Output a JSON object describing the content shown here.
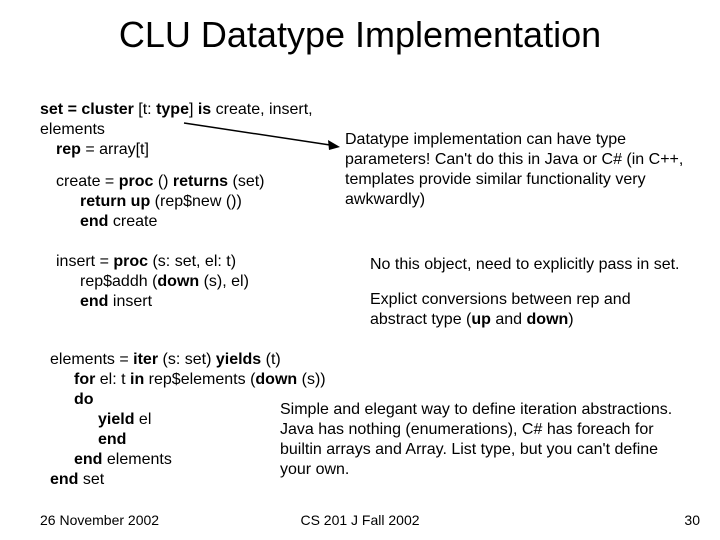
{
  "title": "CLU Datatype Implementation",
  "code": {
    "l1a": "set = cluster ",
    "l1b": "[t: ",
    "l1c": "type",
    "l1d": "] ",
    "l1e": "is ",
    "l1f": "create, insert, elements",
    "l2a": "rep ",
    "l2b": "= array[t]",
    "l3a": "create = ",
    "l3b": "proc",
    "l3c": " () ",
    "l3d": "returns",
    "l3e": " (set)",
    "l4a": "return ",
    "l4b": "up ",
    "l4c": "(rep$new ())",
    "l5a": "end ",
    "l5b": "create",
    "i1a": "insert = ",
    "i1b": "proc",
    "i1c": " (s: set, el: t)",
    "i2a": "rep$addh (",
    "i2b": "down",
    "i2c": " (s), el)",
    "i3a": "end",
    "i3b": " insert",
    "e1a": "elements = ",
    "e1b": "iter",
    "e1c": " (s: set) ",
    "e1d": "yields",
    "e1e": " (t)",
    "e2a": "for ",
    "e2b": "el: t ",
    "e2c": "in",
    "e2d": " rep$elements (",
    "e2e": "down",
    "e2f": " (s)) ",
    "e2g": "do",
    "e3a": "yield",
    "e3b": " el",
    "e4a": "end",
    "e5a": "end",
    "e5b": " elements",
    "e6a": "end",
    "e6b": " set"
  },
  "notes": {
    "n1": "Datatype implementation can have type parameters!  Can't do this in Java or C# (in C++, templates provide similar functionality very awkwardly)",
    "n2a": "No this object, need to explicitly pass in set.",
    "n2b_pre": "Explict conversions between rep and abstract type (",
    "n2b_up": "up",
    "n2b_mid": " and ",
    "n2b_down": "down",
    "n2b_post": ")",
    "n3": "Simple and elegant way to define iteration abstractions.  Java has nothing (enumerations), C# has foreach for builtin arrays and Array. List type, but you can't define your own."
  },
  "footer": {
    "left": "26 November 2002",
    "center": "CS 201 J Fall 2002",
    "right": "30"
  }
}
